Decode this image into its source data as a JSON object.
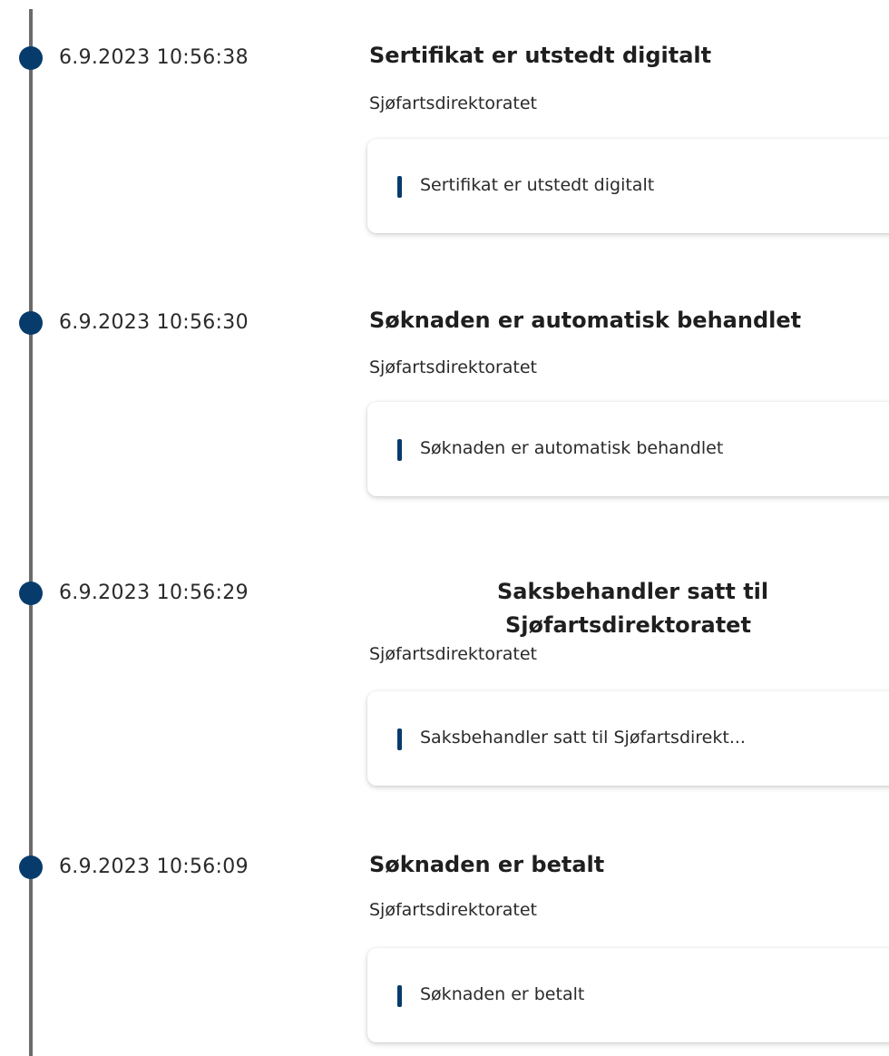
{
  "events": [
    {
      "timestamp": "6.9.2023 10:56:38",
      "title": "Sertifikat er utstedt digitalt",
      "organization": "Sjøfartsdirektoratet",
      "card_text": "Sertifikat er utstedt digitalt"
    },
    {
      "timestamp": "6.9.2023 10:56:30",
      "title": "Søknaden er automatisk behandlet",
      "organization": "Sjøfartsdirektoratet",
      "card_text": "Søknaden er automatisk behandlet"
    },
    {
      "timestamp": "6.9.2023 10:56:29",
      "title_line1": "Saksbehandler satt til",
      "title_line2": "Sjøfartsdirektoratet",
      "organization": "Sjøfartsdirektoratet",
      "card_text": "Saksbehandler satt til Sjøfartsdirekt..."
    },
    {
      "timestamp": "6.9.2023 10:56:09",
      "title": "Søknaden er betalt",
      "organization": "Sjøfartsdirektoratet",
      "card_text": "Søknaden er betalt"
    }
  ],
  "colors": {
    "accent": "#073b6b",
    "timeline_line": "#6b6b6b"
  }
}
